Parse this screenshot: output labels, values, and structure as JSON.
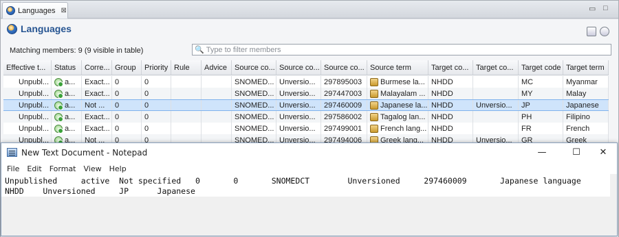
{
  "view": {
    "tab_label": "Languages",
    "tab_close": "⊠",
    "title": "Languages",
    "minimize": "▭",
    "maximize": "□",
    "matching_label": "Matching members: 9 (9 visible in table)",
    "filter_placeholder": "Type to filter members"
  },
  "table": {
    "columns": [
      "Effective t...",
      "Status",
      "Corre...",
      "Group",
      "Priority",
      "Rule",
      "Advice",
      "Source co...",
      "Source co...",
      "Source co...",
      "Source term",
      "Target co...",
      "Target co...",
      "Target code",
      "Target term"
    ],
    "rows": [
      [
        "Unpubl...",
        "a...",
        "Exact...",
        "0",
        "0",
        "",
        "",
        "SNOMED...",
        "Unversio...",
        "297895003",
        "Burmese la...",
        "NHDD",
        "",
        "MC",
        "Myanmar"
      ],
      [
        "Unpubl...",
        "a...",
        "Exact...",
        "0",
        "0",
        "",
        "",
        "SNOMED...",
        "Unversio...",
        "297447003",
        "Malayalam ...",
        "NHDD",
        "",
        "MY",
        "Malay"
      ],
      [
        "Unpubl...",
        "a...",
        "Not ...",
        "0",
        "0",
        "",
        "",
        "SNOMED...",
        "Unversio...",
        "297460009",
        "Japanese la...",
        "NHDD",
        "Unversio...",
        "JP",
        "Japanese"
      ],
      [
        "Unpubl...",
        "a...",
        "Exact...",
        "0",
        "0",
        "",
        "",
        "SNOMED...",
        "Unversio...",
        "297586002",
        "Tagalog lan...",
        "NHDD",
        "",
        "PH",
        "Filipino"
      ],
      [
        "Unpubl...",
        "a...",
        "Exact...",
        "0",
        "0",
        "",
        "",
        "SNOMED...",
        "Unversio...",
        "297499001",
        "French lang...",
        "NHDD",
        "",
        "FR",
        "French"
      ],
      [
        "Unpubl...",
        "a...",
        "Not ...",
        "0",
        "0",
        "",
        "",
        "SNOMED...",
        "Unversio...",
        "297494006",
        "Greek lang...",
        "NHDD",
        "Unversio...",
        "GR",
        "Greek"
      ]
    ],
    "selected_row": 2
  },
  "notepad": {
    "title": "New Text Document - Notepad",
    "minimize": "—",
    "maximize": "☐",
    "close": "✕",
    "menu": [
      "File",
      "Edit",
      "Format",
      "View",
      "Help"
    ],
    "lines": [
      "Unpublished     active  Not specified   0       0       SNOMEDCT        Unversioned     297460009       Japanese language",
      "NHDD    Unversioned     JP      Japanese"
    ]
  },
  "colors": {
    "title_blue": "#275592",
    "selection": "#cfe4fb"
  }
}
